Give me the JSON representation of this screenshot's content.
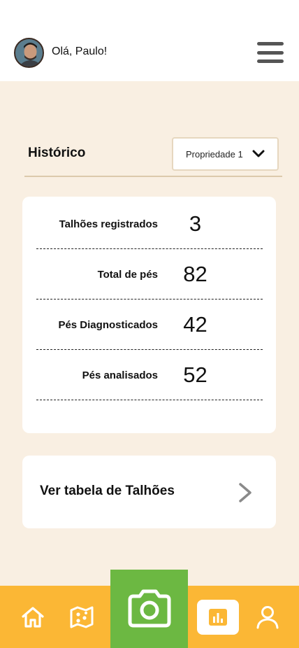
{
  "header": {
    "greeting": "Olá, Paulo!",
    "avatar_icon": "user-avatar-photo",
    "menu_icon": "hamburger-menu-icon"
  },
  "history": {
    "title": "Histórico",
    "property_select": {
      "value": "Propriedade 1",
      "icon": "chevron-down-icon"
    }
  },
  "stats": [
    {
      "label": "Talhões registrados",
      "value": "3"
    },
    {
      "label": "Total de pés",
      "value": "82"
    },
    {
      "label": "Pés Diagnosticados",
      "value": "42"
    },
    {
      "label": "Pés analisados",
      "value": "52"
    }
  ],
  "table_link": {
    "label": "Ver tabela de Talhões",
    "icon": "chevron-right-icon"
  },
  "bottom_nav": {
    "items": [
      "home-icon",
      "map-icon",
      "camera-icon",
      "bar-chart-icon",
      "profile-icon"
    ],
    "active": "bar-chart-icon"
  },
  "colors": {
    "background": "#f9efe2",
    "nav_bar": "#fbb735",
    "camera_button": "#6cb842",
    "card": "#ffffff"
  }
}
